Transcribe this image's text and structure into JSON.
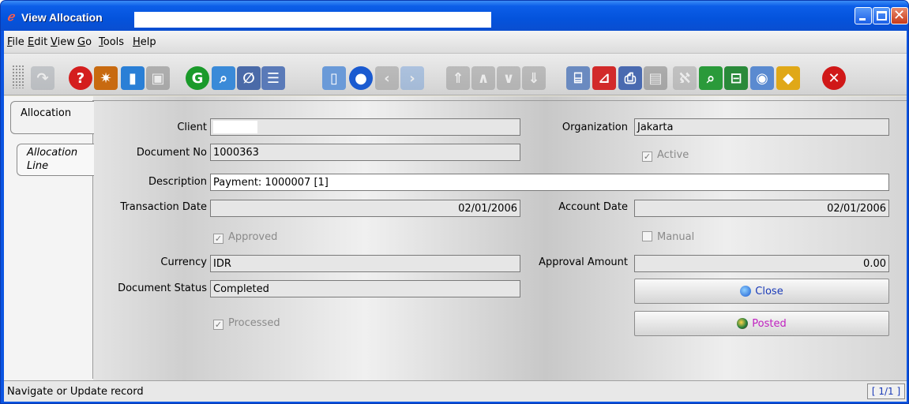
{
  "window": {
    "title": "View Allocation"
  },
  "menu": {
    "items": [
      {
        "key": "F",
        "rest": "ile"
      },
      {
        "key": "E",
        "rest": "dit"
      },
      {
        "key": "V",
        "rest": "iew"
      },
      {
        "key": "G",
        "rest": "o"
      },
      {
        "key": "T",
        "rest": "ools"
      },
      {
        "key": "H",
        "rest": "elp"
      }
    ]
  },
  "toolbar": {
    "icons": [
      "ignore-icon",
      "help-icon",
      "new-record-icon",
      "save-icon",
      "delete-icon",
      "refresh-icon",
      "find-icon",
      "attachment-icon",
      "grid-toggle-icon",
      "history-icon",
      "home-icon",
      "previous-icon",
      "next-icon",
      "first-record-icon",
      "previous-record-icon",
      "next-record-icon",
      "last-record-icon",
      "print-preview-icon",
      "pdf-icon",
      "print-icon",
      "report-icon",
      "zoom-across-icon",
      "active-workflows-icon",
      "requests-icon",
      "archive-icon",
      "exit-icon"
    ]
  },
  "tabs": {
    "active": "Allocation",
    "inactive": "Allocation Line"
  },
  "form": {
    "client_label": "Client",
    "client_value": "",
    "organization_label": "Organization",
    "organization_value": "Jakarta",
    "document_no_label": "Document No",
    "document_no_value": "1000363",
    "active_label": "Active",
    "description_label": "Description",
    "description_value": "Payment: 1000007 [1]",
    "transaction_date_label": "Transaction Date",
    "transaction_date_value": "02/01/2006",
    "account_date_label": "Account Date",
    "account_date_value": "02/01/2006",
    "approved_label": "Approved",
    "manual_label": "Manual",
    "currency_label": "Currency",
    "currency_value": "IDR",
    "approval_amount_label": "Approval Amount",
    "approval_amount_value": "0.00",
    "document_status_label": "Document Status",
    "document_status_value": "Completed",
    "processed_label": "Processed",
    "close_button": "Close",
    "posted_button": "Posted"
  },
  "status": {
    "text": "Navigate or Update record",
    "record": "[ 1/1 ]"
  },
  "colors": {
    "title_bar": "#0453dc",
    "posted_text": "#c020c0",
    "close_text": "#1a3ab8"
  }
}
